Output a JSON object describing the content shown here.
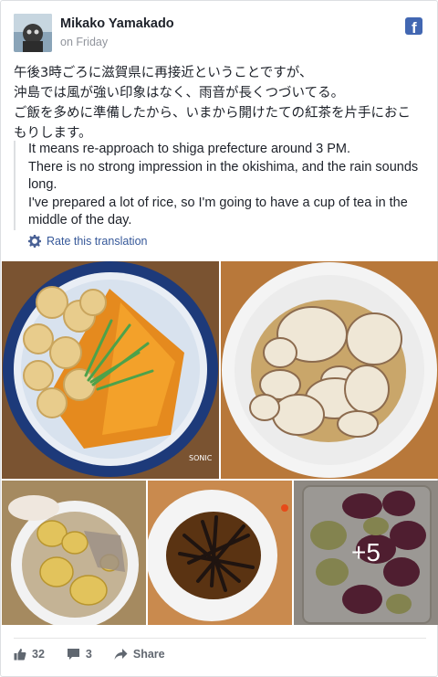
{
  "post": {
    "author": "Mikako Yamakado",
    "timestamp": "on Friday",
    "original_lines": [
      "午後3時ごろに滋賀県に再接近ということですが、",
      "沖島では風が強い印象はなく、雨音が長くつづいてる。",
      "ご飯を多めに準備したから、いまから開けたての紅茶を片手におこ",
      "もりします。"
    ],
    "translation_lines": [
      "It means re-approach to shiga prefecture around 3 PM.",
      "There is no strong impression in the okishima, and the rain sounds long.",
      "I've prepared a lot of rice, so I'm going to have a cup of tea in the middle of the day."
    ],
    "rate_translation": "Rate this translation",
    "more_photos": "+5"
  },
  "footer": {
    "likes": "32",
    "comments": "3",
    "share": "Share"
  },
  "icons": {
    "logo": "facebook-logo-icon",
    "gear": "gear-icon",
    "like": "thumbs-up-icon",
    "comment": "comment-icon",
    "share": "share-arrow-icon"
  },
  "colors": {
    "fb_blue": "#4267b2",
    "link": "#365899",
    "muted": "#90949c"
  }
}
